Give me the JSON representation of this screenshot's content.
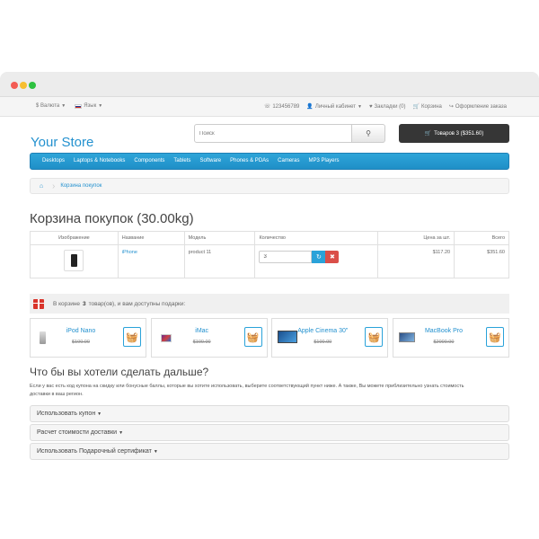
{
  "topbar": {
    "currency": "$ Валюта",
    "language": "Язык",
    "phone": "123456789",
    "account": "Личный кабинет",
    "wishlist": "Закладки (0)",
    "cart": "Корзина",
    "checkout": "Оформление заказа"
  },
  "header": {
    "logo": "Your Store",
    "search_placeholder": "Поиск",
    "cart_button": "Товаров 3 ($351.60)"
  },
  "nav": [
    "Desktops",
    "Laptops & Notebooks",
    "Components",
    "Tablets",
    "Software",
    "Phones & PDAs",
    "Cameras",
    "MP3 Players"
  ],
  "breadcrumb": {
    "current": "Корзина покупок"
  },
  "page_title": "Корзина покупок  (30.00kg)",
  "table": {
    "headers": [
      "Изображение",
      "Название",
      "Модель",
      "Количество",
      "Цена за шт.",
      "Всего"
    ],
    "rows": [
      {
        "name": "iPhone",
        "model": "product 11",
        "quantity": "3",
        "unit_price": "$117.20",
        "total": "$351.60"
      }
    ]
  },
  "gift": {
    "prefix": "В корзине",
    "count": "3",
    "suffix": "товар(ов), и вам доступны подарки:",
    "items": [
      {
        "name": "iPod Nano",
        "price": "$100.00"
      },
      {
        "name": "iMac",
        "price": "$100.00"
      },
      {
        "name": "Apple Cinema 30\"",
        "price": "$100.00"
      },
      {
        "name": "MacBook Pro",
        "price": "$2000.00"
      }
    ]
  },
  "next": {
    "title": "Что бы вы хотели сделать дальше?",
    "description": "Если у вас есть код купона на скидку или бонусные баллы, которые вы хотите использовать, выберите соответствующий пункт ниже. А также, Вы можете приблизительно узнать стоимость доставки в ваш регион.",
    "panels": [
      "Использовать купон",
      "Расчет стоимости доставки",
      "Использовать Подарочный сертификат"
    ]
  }
}
